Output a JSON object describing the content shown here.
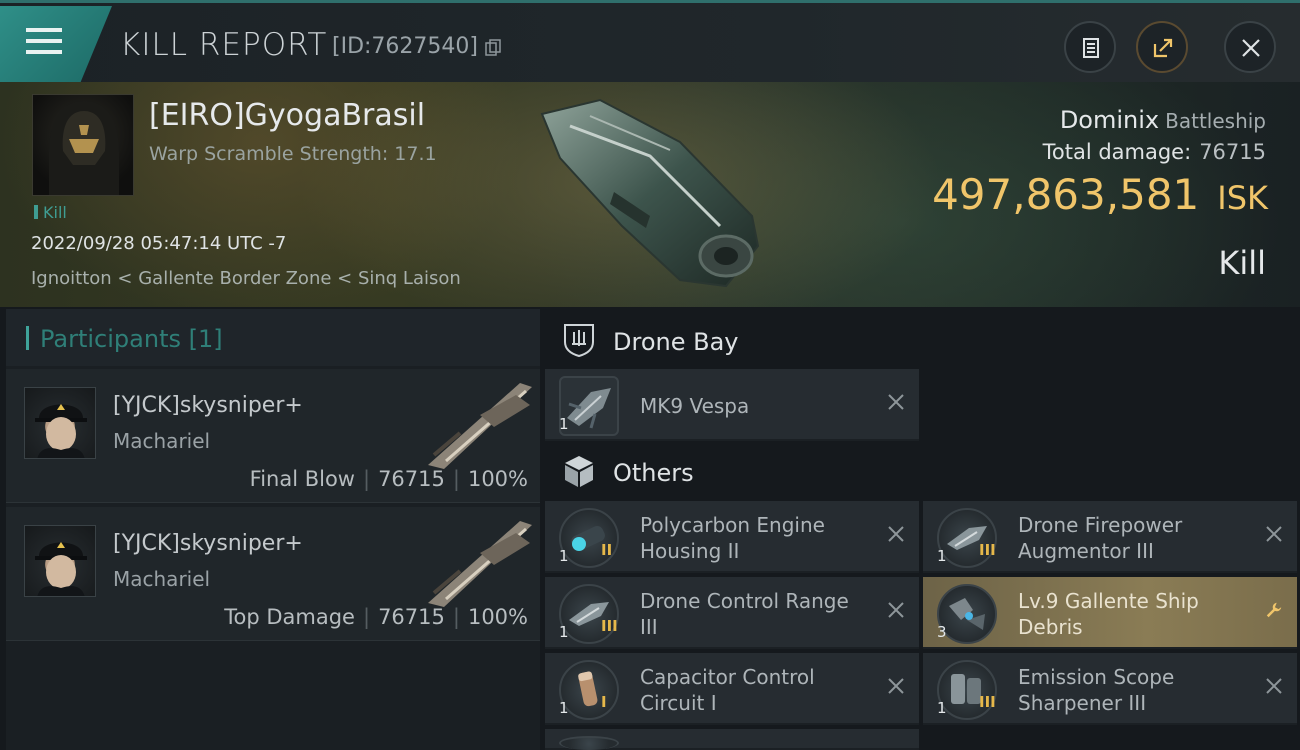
{
  "header": {
    "title": "KILL REPORT",
    "report_id": "[ID:7627540]"
  },
  "victim": {
    "name": "[EIRO]GyogaBrasil",
    "warp_scramble": "Warp Scramble Strength: 17.1",
    "tag": "Kill",
    "datetime": "2022/09/28 05:47:14 UTC -7",
    "location": "Ignoitton < Gallente Border Zone < Sinq Laison",
    "ship": "Dominix",
    "ship_class": "Battleship",
    "total_damage_label": "Total damage:",
    "total_damage": "76715",
    "isk_value": "497,863,581",
    "isk_unit": "ISK",
    "result": "Kill"
  },
  "participants": {
    "title": "Participants [1]",
    "items": [
      {
        "name": "[YJCK]skysniper+",
        "ship": "Machariel",
        "role": "Final Blow",
        "damage": "76715",
        "percent": "100%"
      },
      {
        "name": "[YJCK]skysniper+",
        "ship": "Machariel",
        "role": "Top Damage",
        "damage": "76715",
        "percent": "100%"
      }
    ]
  },
  "drone_bay": {
    "title": "Drone Bay",
    "items": [
      {
        "name": "MK9  Vespa",
        "qty": "1",
        "icon": "drone-icon"
      }
    ]
  },
  "others": {
    "title": "Others",
    "items": [
      {
        "line1": "Polycarbon Engine",
        "line2": "Housing II",
        "qty": "1",
        "tier": "II",
        "icon": "engine-module-icon"
      },
      {
        "line1": "Drone Firepower",
        "line2": "Augmentor III",
        "qty": "1",
        "tier": "III",
        "icon": "drone-rig-icon"
      },
      {
        "line1": "Drone Control Range",
        "line2": "III",
        "qty": "1",
        "tier": "III",
        "icon": "drone-rig-icon"
      },
      {
        "line1": "Lv.9 Gallente Ship",
        "line2": "Debris",
        "qty": "3",
        "tier": "",
        "icon": "debris-icon"
      },
      {
        "line1": "Capacitor Control",
        "line2": "Circuit I",
        "qty": "1",
        "tier": "I",
        "icon": "capacitor-rig-icon"
      },
      {
        "line1": "Emission Scope",
        "line2": "Sharpener III",
        "qty": "1",
        "tier": "III",
        "icon": "scope-rig-icon"
      }
    ]
  },
  "colors": {
    "accent_teal": "#3fa39a",
    "isk_gold": "#f0c56a",
    "highlight_item": "#8a7c55"
  }
}
